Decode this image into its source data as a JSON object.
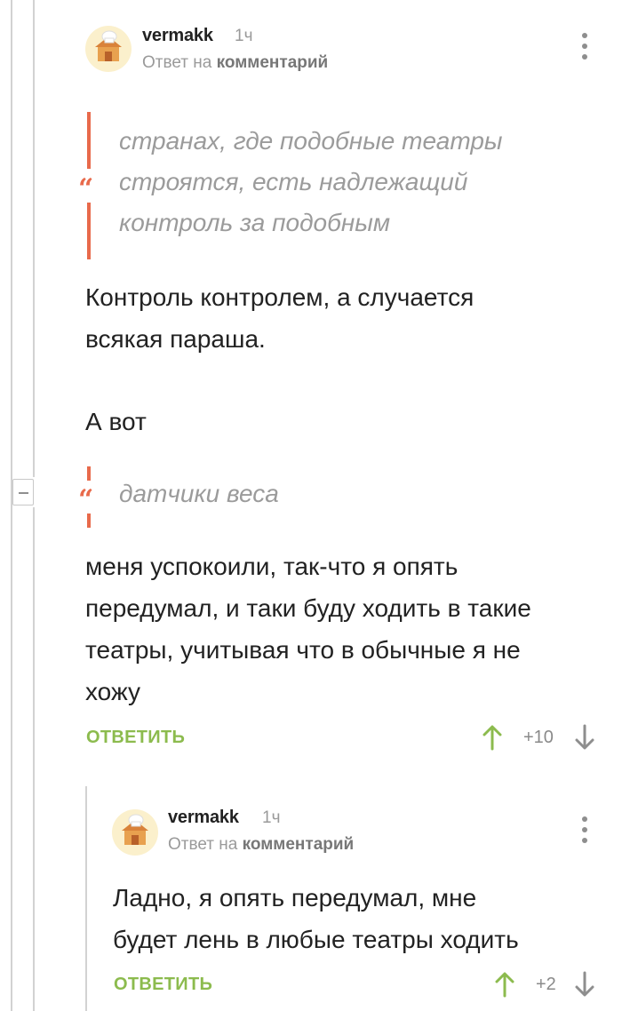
{
  "comments": [
    {
      "author": "vermakk",
      "time": "1ч",
      "reply_prefix": "Ответ на",
      "reply_target": "комментарий",
      "quote1": [
        "странах, где подобные театры",
        "строятся, есть надлежащий",
        "контроль за подобным"
      ],
      "para1": [
        "Контроль контролем, а случается",
        "всякая параша."
      ],
      "para2": [
        "А вот"
      ],
      "quote2": [
        "датчики веса"
      ],
      "para3": [
        "меня успокоили, так-что я опять",
        "передумал, и таки буду ходить в такие",
        "театры, учитывая что в обычные я не",
        "хожу"
      ],
      "reply_label": "ОТВЕТИТЬ",
      "score": "+10"
    },
    {
      "author": "vermakk",
      "time": "1ч",
      "reply_prefix": "Ответ на",
      "reply_target": "комментарий",
      "para1": [
        "Ладно, я опять передумал, мне",
        "будет лень в любые театры ходить"
      ],
      "reply_label": "ОТВЕТИТЬ",
      "score": "+2"
    }
  ],
  "icons": {
    "avatar": "chef-house-avatar",
    "menu": "more-vertical-icon",
    "upvote": "arrow-up-icon",
    "downvote": "arrow-down-icon",
    "quote": "quote-mark-icon",
    "collapse": "collapse-minus-icon"
  },
  "colors": {
    "accent_green": "#8cbb4e",
    "quote_red": "#e86a4b",
    "muted_gray": "#9a9a9a"
  }
}
